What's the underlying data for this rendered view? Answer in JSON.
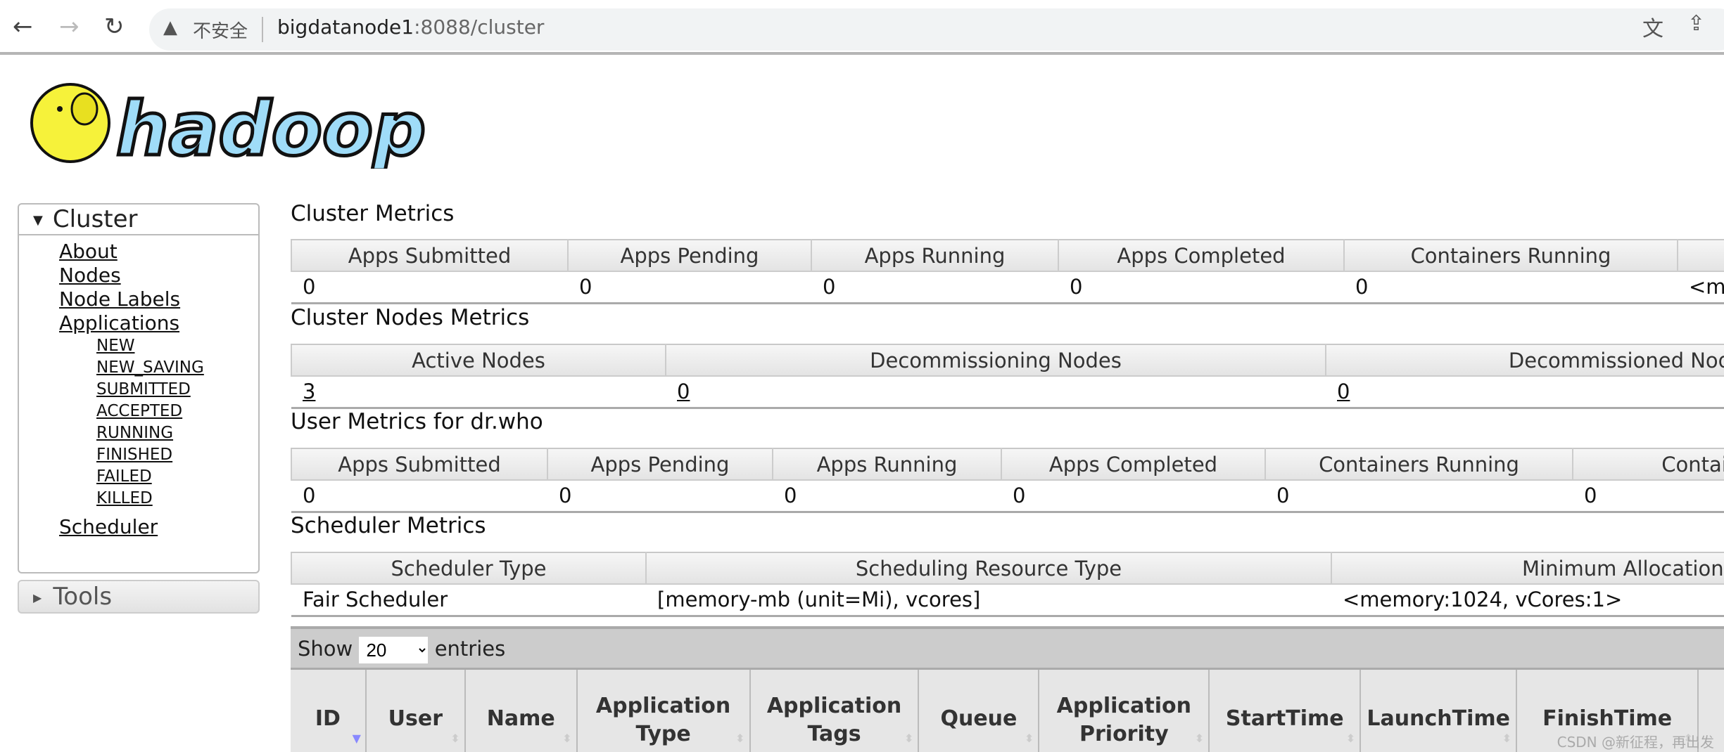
{
  "browser": {
    "security": "不安全",
    "url_host": "bigdatanode1",
    "url_rest": ":8088/cluster"
  },
  "logo": "hadoop",
  "sidebar": {
    "cluster": "Cluster",
    "links": [
      "About",
      "Nodes",
      "Node Labels",
      "Applications"
    ],
    "states": [
      "NEW",
      "NEW_SAVING",
      "SUBMITTED",
      "ACCEPTED",
      "RUNNING",
      "FINISHED",
      "FAILED",
      "KILLED"
    ],
    "scheduler": "Scheduler",
    "tools": "Tools"
  },
  "cluster_metrics": {
    "title": "Cluster Metrics",
    "headers": [
      "Apps Submitted",
      "Apps Pending",
      "Apps Running",
      "Apps Completed",
      "Containers Running",
      ""
    ],
    "values": [
      "0",
      "0",
      "0",
      "0",
      "0",
      "<me"
    ]
  },
  "nodes_metrics": {
    "title": "Cluster Nodes Metrics",
    "headers": [
      "Active Nodes",
      "Decommissioning Nodes",
      "Decommissioned Nodes"
    ],
    "values": [
      "3",
      "0",
      "0"
    ]
  },
  "user_metrics": {
    "title": "User Metrics for dr.who",
    "headers": [
      "Apps Submitted",
      "Apps Pending",
      "Apps Running",
      "Apps Completed",
      "Containers Running",
      "Container"
    ],
    "values": [
      "0",
      "0",
      "0",
      "0",
      "0",
      "0"
    ]
  },
  "scheduler_metrics": {
    "title": "Scheduler Metrics",
    "headers": [
      "Scheduler Type",
      "Scheduling Resource Type",
      "Minimum Allocation"
    ],
    "values": [
      "Fair Scheduler",
      "[memory-mb (unit=Mi), vcores]",
      "<memory:1024, vCores:1>"
    ]
  },
  "apps": {
    "show": "Show",
    "entries": "entries",
    "page_size": "20",
    "columns": [
      "ID",
      "User",
      "Name",
      "Application Type",
      "Application Tags",
      "Queue",
      "Application Priority",
      "StartTime",
      "LaunchTime",
      "FinishTime"
    ]
  },
  "watermark": "CSDN @新征程，再出发"
}
